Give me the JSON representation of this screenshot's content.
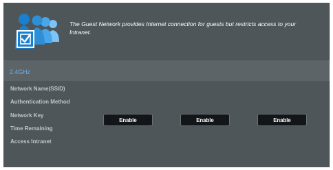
{
  "header": {
    "description": "The Guest Network provides Internet connection for guests but restricts access to your Intranet.",
    "icon": "guest-network-icon"
  },
  "band": {
    "label": "2.4GHz"
  },
  "rows": [
    {
      "label": "Network Name(SSID)"
    },
    {
      "label": "Authentication Method"
    },
    {
      "label": "Network Key"
    },
    {
      "label": "Time Remaining"
    },
    {
      "label": "Access Intranet"
    }
  ],
  "buttons": [
    {
      "label": "Enable"
    },
    {
      "label": "Enable"
    },
    {
      "label": "Enable"
    }
  ],
  "colors": {
    "panel": "#4f5659",
    "accent": "#6aaef0",
    "icon_blue": "#2e8fd6"
  }
}
